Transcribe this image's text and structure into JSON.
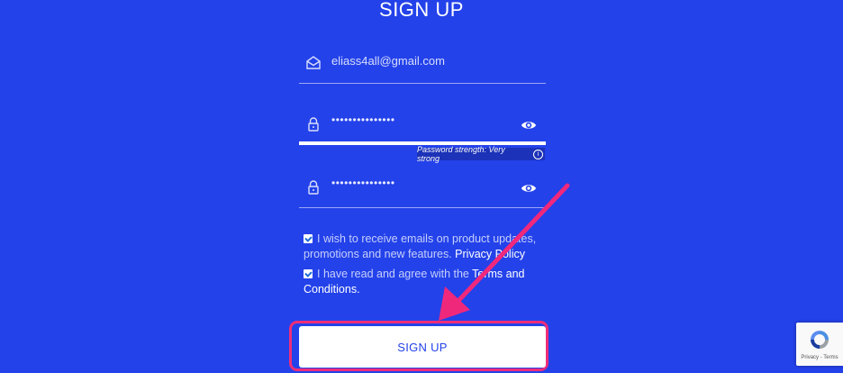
{
  "form": {
    "title": "SIGN UP",
    "email_value": "eliass4all@gmail.com",
    "password_masked": "•••••••••••••••",
    "confirm_masked": "•••••••••••••••",
    "password_strength": "Password strength: Very strong",
    "password_strength_fraction": 1.0,
    "consent_emails_text": "I wish to receive emails on product updates, promotions and new features.",
    "consent_emails_link": "Privacy Policy",
    "consent_terms_text": "I have read and agree with the",
    "consent_terms_link": "Terms and Conditions.",
    "submit_label": "SIGN UP"
  },
  "recaptcha": {
    "links_text": "Privacy - Terms"
  },
  "colors": {
    "background": "#2342ea",
    "highlight": "#ef2d79",
    "arrow": "#f0287c"
  },
  "icons": {
    "email": "envelope-icon",
    "password": "lock-icon",
    "visibility": "eye-icon",
    "info": "info-icon"
  }
}
